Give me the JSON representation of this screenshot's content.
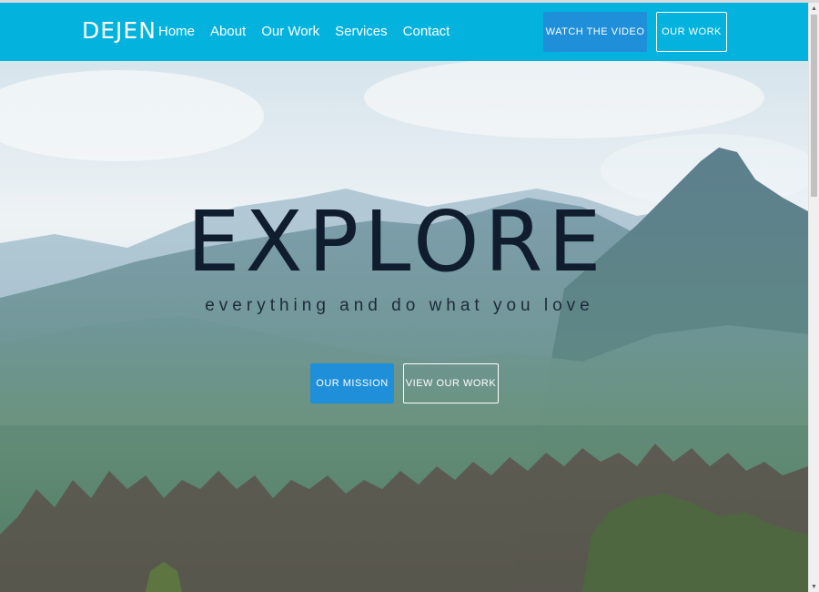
{
  "nav": {
    "brand": "DEJEN",
    "links": [
      "Home",
      "About",
      "Our Work",
      "Services",
      "Contact"
    ],
    "watch_video": "WATCH THE VIDEO",
    "our_work": "OUR WORK"
  },
  "hero": {
    "title": "EXPLORE",
    "subtitle": "everything and do what you love",
    "mission_button": "OUR MISSION",
    "view_work_button": "VIEW OUR WORK"
  },
  "colors": {
    "accent": "#03b3dd",
    "button_blue": "#1e8fd8",
    "title_text": "#0f1d2f"
  },
  "icons": {
    "scroll_up": "scroll-up-arrow-icon",
    "scroll_down": "scroll-down-arrow-icon"
  }
}
